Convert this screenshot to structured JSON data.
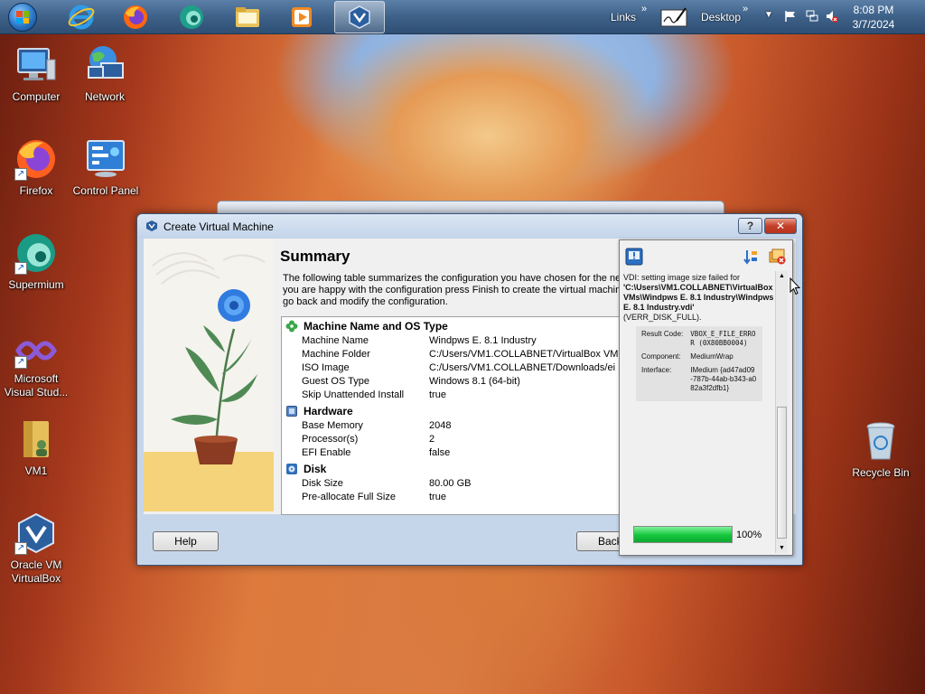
{
  "taskbar": {
    "pinned": [
      {
        "name": "start-button",
        "icon": "windows-logo-icon"
      },
      {
        "name": "internet-explorer",
        "icon": "internet-explorer-icon"
      },
      {
        "name": "firefox",
        "icon": "firefox-icon"
      },
      {
        "name": "supermium",
        "icon": "supermium-icon"
      },
      {
        "name": "file-explorer",
        "icon": "folder-icon"
      },
      {
        "name": "media-player",
        "icon": "media-player-icon"
      },
      {
        "name": "virtualbox",
        "icon": "virtualbox-icon",
        "active": true
      }
    ],
    "links_label": "Links",
    "desktop_label": "Desktop",
    "time": "8:08 PM",
    "date": "3/7/2024"
  },
  "desktop_icons": [
    {
      "label": "Computer",
      "icon": "computer-icon"
    },
    {
      "label": "Network",
      "icon": "network-icon"
    },
    {
      "label": "Firefox",
      "icon": "firefox-icon"
    },
    {
      "label": "Control Panel",
      "icon": "control-panel-icon"
    },
    {
      "label": "Supermium",
      "icon": "supermium-icon"
    },
    {
      "label": "Microsoft Visual Stud...",
      "icon": "visual-studio-icon"
    },
    {
      "label": "VM1",
      "icon": "user-folder-icon"
    },
    {
      "label": "Oracle VM VirtualBox",
      "icon": "virtualbox-icon"
    },
    {
      "label": "Recycle Bin",
      "icon": "recycle-bin-icon"
    }
  ],
  "dialog": {
    "title": "Create Virtual Machine",
    "help_caption": "?",
    "close_caption": "✕",
    "summary_title": "Summary",
    "summary_lines": [
      "The following table summarizes the configuration you have chosen for the new",
      "you are happy with the configuration press Finish to create the virtual machine",
      "go back and modify the configuration."
    ],
    "sections": [
      {
        "title": "Machine Name and OS Type",
        "icon": "clover-icon",
        "rows": [
          {
            "key": "Machine Name",
            "value": "Windpws E. 8.1 Industry"
          },
          {
            "key": "Machine Folder",
            "value": "C:/Users/VM1.COLLABNET/VirtualBox VM"
          },
          {
            "key": "ISO Image",
            "value": "C:/Users/VM1.COLLABNET/Downloads/ei"
          },
          {
            "key": "Guest OS Type",
            "value": "Windows 8.1 (64-bit)"
          },
          {
            "key": "Skip Unattended Install",
            "value": "true"
          }
        ]
      },
      {
        "title": "Hardware",
        "icon": "chip-icon",
        "rows": [
          {
            "key": "Base Memory",
            "value": "2048"
          },
          {
            "key": "Processor(s)",
            "value": "2"
          },
          {
            "key": "EFI Enable",
            "value": "false"
          }
        ]
      },
      {
        "title": "Disk",
        "icon": "disk-icon",
        "rows": [
          {
            "key": "Disk Size",
            "value": "80.00 GB"
          },
          {
            "key": "Pre-allocate Full Size",
            "value": "true"
          }
        ]
      }
    ],
    "help_button": "Help",
    "back_button": "Back"
  },
  "notification": {
    "message_prefix": "VDI: setting image size failed for",
    "path": "'C:\\Users\\VM1.COLLABNET\\VirtualBox VMs\\Windpws E. 8.1 Industry\\Windpws E. 8.1 Industry.vdi'",
    "error_code": "(VERR_DISK_FULL).",
    "details": [
      {
        "key": "Result Code:",
        "value": "VBOX_E_FILE_ERROR (0X80BB0004)"
      },
      {
        "key": "Component:",
        "value": "MediumWrap"
      },
      {
        "key": "Interface:",
        "value": "IMedium {ad47ad09-787b-44ab-b343-a082a3f2dfb1}"
      }
    ],
    "progress": 100,
    "progress_label": "100%"
  }
}
